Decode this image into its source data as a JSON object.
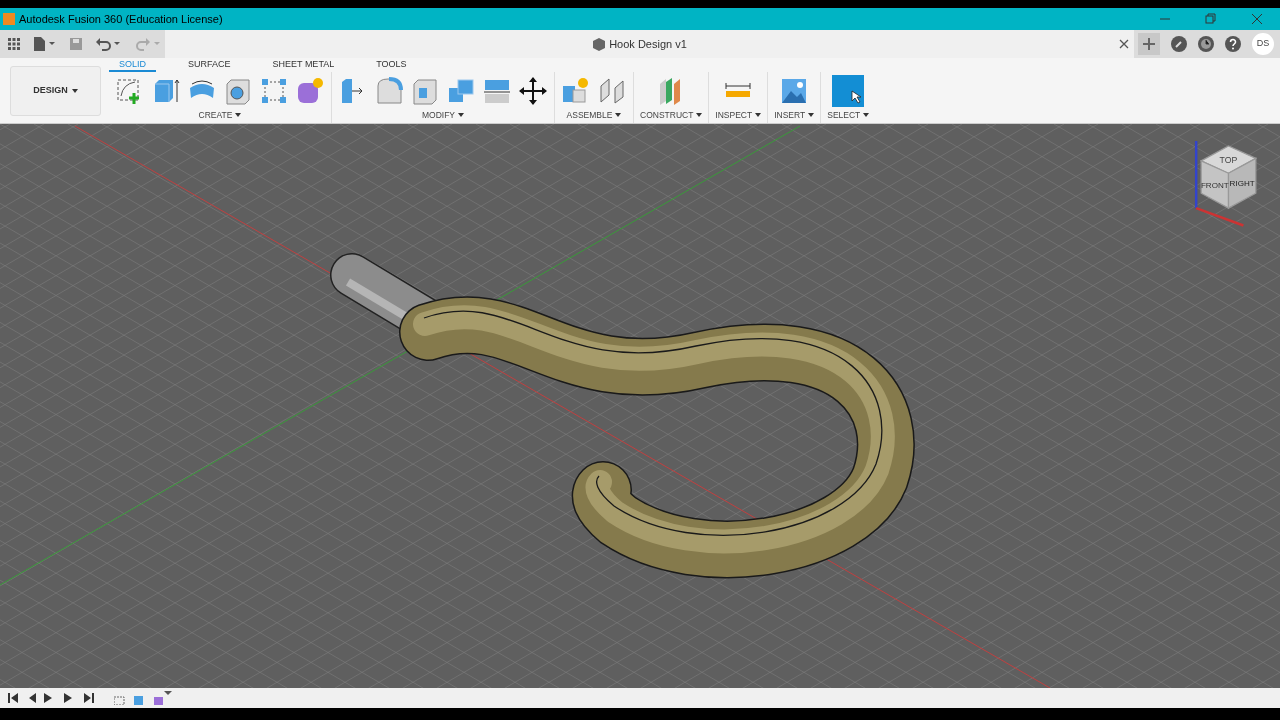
{
  "window": {
    "title": "Autodesk Fusion 360 (Education License)"
  },
  "document": {
    "title": "Hook Design v1"
  },
  "user": {
    "initials": "DS"
  },
  "workspace": {
    "label": "DESIGN"
  },
  "ribbon_tabs": [
    {
      "label": "SOLID",
      "selected": true
    },
    {
      "label": "SURFACE",
      "selected": false
    },
    {
      "label": "SHEET METAL",
      "selected": false
    },
    {
      "label": "TOOLS",
      "selected": false
    }
  ],
  "tool_groups": [
    {
      "label": "CREATE"
    },
    {
      "label": "MODIFY"
    },
    {
      "label": "ASSEMBLE"
    },
    {
      "label": "CONSTRUCT"
    },
    {
      "label": "INSPECT"
    },
    {
      "label": "INSERT"
    },
    {
      "label": "SELECT"
    }
  ],
  "view_cube": {
    "faces": [
      "TOP",
      "FRONT",
      "RIGHT"
    ]
  }
}
